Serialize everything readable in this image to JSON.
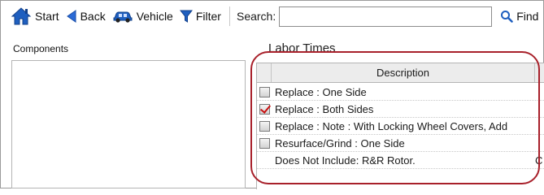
{
  "toolbar": {
    "start_label": "Start",
    "back_label": "Back",
    "vehicle_label": "Vehicle",
    "filter_label": "Filter",
    "search_label": "Search:",
    "search_value": "",
    "find_label": "Find",
    "icons": {
      "start": "home-icon",
      "back": "back-arrow-icon",
      "vehicle": "car-icon",
      "filter": "filter-funnel-icon",
      "find": "magnifier-icon"
    },
    "icon_color": "#1f5fbf"
  },
  "components": {
    "title": "Components"
  },
  "labor": {
    "title": "Labor Times",
    "column_description": "Description",
    "rows": [
      {
        "checkbox": true,
        "checked": false,
        "description": "Replace : One Side",
        "extra": ""
      },
      {
        "checkbox": true,
        "checked": true,
        "description": "Replace : Both Sides",
        "extra": ""
      },
      {
        "checkbox": true,
        "checked": false,
        "description": "Replace : Note : With Locking Wheel Covers, Add",
        "extra": ""
      },
      {
        "checkbox": true,
        "checked": false,
        "description": "Resurface/Grind : One Side",
        "extra": ""
      },
      {
        "checkbox": false,
        "checked": false,
        "description": "Does Not Include: R&R Rotor.",
        "extra": "C"
      }
    ]
  },
  "highlight_color": "#a8202a"
}
